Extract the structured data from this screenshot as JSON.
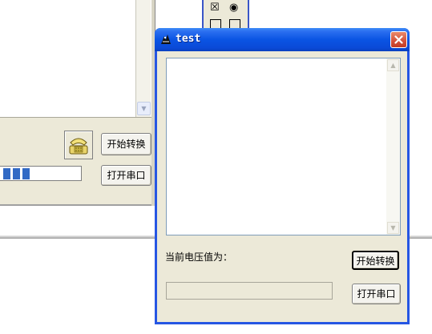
{
  "background_window": {
    "start_convert_label": "开始转换",
    "open_port_label": "打开串口",
    "progress_segments": 3
  },
  "top_strip": {
    "checkbox_glyph": "☒",
    "radio_glyph": "◉"
  },
  "dialog": {
    "title": "test",
    "voltage_label": "当前电压值为：",
    "start_convert_label": "开始转换",
    "open_port_label": "打开串口",
    "progress": 0
  },
  "icons": {
    "app": "app-icon",
    "close": "close-icon",
    "phone": "phone-icon"
  }
}
